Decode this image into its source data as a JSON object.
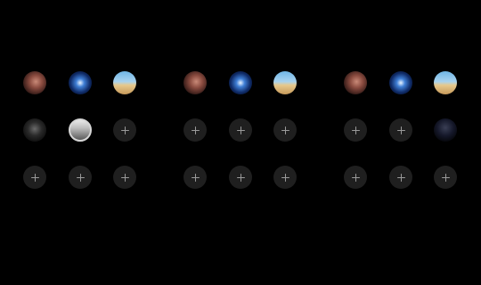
{
  "stories": {
    "rows": [
      {
        "row": 1,
        "items": [
          {
            "type": "photo",
            "icon": "profile-photo-woman-icon"
          },
          {
            "type": "photo",
            "icon": "profile-photo-candle-icon"
          },
          {
            "type": "photo",
            "icon": "profile-photo-beach-icon"
          },
          {
            "type": "photo",
            "icon": "profile-photo-woman-icon"
          },
          {
            "type": "photo",
            "icon": "profile-photo-candle-icon"
          },
          {
            "type": "photo",
            "icon": "profile-photo-beach-icon"
          },
          {
            "type": "photo",
            "icon": "profile-photo-woman-icon"
          },
          {
            "type": "photo",
            "icon": "profile-photo-candle-icon"
          },
          {
            "type": "photo",
            "icon": "profile-photo-beach-icon"
          }
        ]
      },
      {
        "row": 2,
        "items": [
          {
            "type": "photo",
            "icon": "profile-photo-dark-icon"
          },
          {
            "type": "photo",
            "icon": "profile-photo-man-icon"
          },
          {
            "type": "add",
            "icon": "plus-icon"
          },
          {
            "type": "add",
            "icon": "plus-icon"
          },
          {
            "type": "add",
            "icon": "plus-icon"
          },
          {
            "type": "add",
            "icon": "plus-icon"
          },
          {
            "type": "add",
            "icon": "plus-icon"
          },
          {
            "type": "add",
            "icon": "plus-icon"
          },
          {
            "type": "photo",
            "icon": "profile-photo-hooded-icon"
          }
        ]
      },
      {
        "row": 3,
        "items": [
          {
            "type": "add",
            "icon": "plus-icon"
          },
          {
            "type": "add",
            "icon": "plus-icon"
          },
          {
            "type": "add",
            "icon": "plus-icon"
          },
          {
            "type": "add",
            "icon": "plus-icon"
          },
          {
            "type": "add",
            "icon": "plus-icon"
          },
          {
            "type": "add",
            "icon": "plus-icon"
          },
          {
            "type": "add",
            "icon": "plus-icon"
          },
          {
            "type": "add",
            "icon": "plus-icon"
          },
          {
            "type": "add",
            "icon": "plus-icon"
          }
        ]
      }
    ]
  },
  "colors": {
    "background": "#000000",
    "empty_slot": "#1f1f1f",
    "plus": "#9a9a9a"
  }
}
